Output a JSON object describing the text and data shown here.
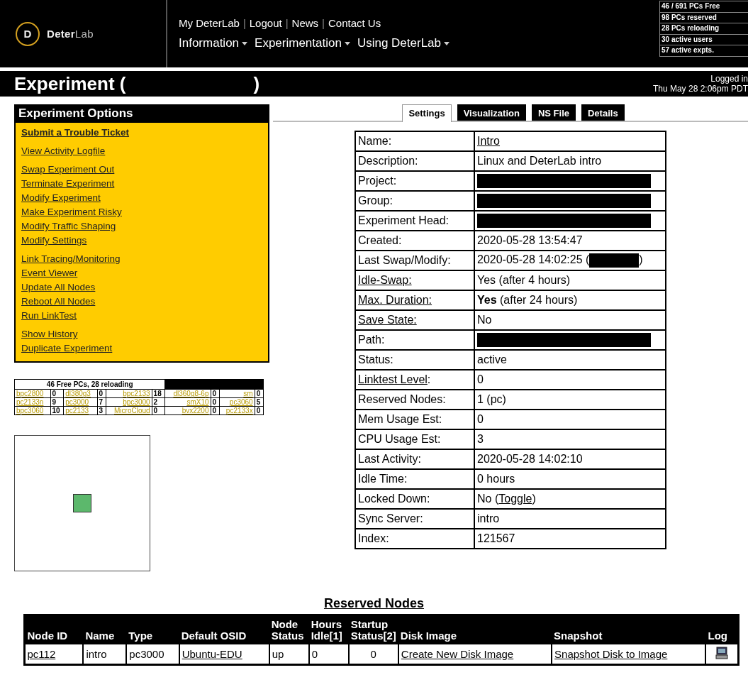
{
  "header": {
    "logo": {
      "letter": "D",
      "name_bold": "Deter",
      "name_light": "Lab"
    },
    "top_links": [
      "My DeterLab",
      "Logout",
      "News",
      "Contact Us"
    ],
    "separator": "|",
    "menus": [
      "Information",
      "Experimentation",
      "Using DeterLab"
    ],
    "stats": [
      "46 / 691 PCs Free",
      "98 PCs reserved",
      "28 PCs reloading",
      "30 active users",
      "57 active expts."
    ]
  },
  "title_bar": {
    "title": "Experiment (",
    "title_end": ")",
    "logged_in": "Logged in",
    "date": "Thu May 28 2:06pm PDT"
  },
  "options": {
    "title": "Experiment Options",
    "groups": [
      [
        {
          "label": "Submit a Trouble Ticket",
          "bold": true
        }
      ],
      [
        {
          "label": "View Activity Logfile",
          "bold": false
        }
      ],
      [
        {
          "label": "Swap Experiment Out",
          "bold": false
        },
        {
          "label": "Terminate Experiment",
          "bold": false
        },
        {
          "label": "Modify Experiment",
          "bold": false
        },
        {
          "label": "Make Experiment Risky",
          "bold": false
        },
        {
          "label": "Modify Traffic Shaping",
          "bold": false
        },
        {
          "label": "Modify Settings",
          "bold": false
        }
      ],
      [
        {
          "label": "Link Tracing/Monitoring",
          "bold": false
        },
        {
          "label": "Event Viewer",
          "bold": false
        },
        {
          "label": "Update All Nodes",
          "bold": false
        },
        {
          "label": "Reboot All Nodes",
          "bold": false
        },
        {
          "label": "Run LinkTest",
          "bold": false
        }
      ],
      [
        {
          "label": "Show History",
          "bold": false
        },
        {
          "label": "Duplicate Experiment",
          "bold": false
        }
      ]
    ]
  },
  "free_pcs": {
    "title": "46 Free PCs, 28 reloading",
    "rows": [
      [
        {
          "type": "bpc2800",
          "count": "0"
        },
        {
          "type": "dl380g3",
          "count": "0"
        },
        {
          "type": "bpc2133",
          "count": "18"
        },
        {
          "type": "dl360g8-6p",
          "count": "0"
        },
        {
          "type": "sm",
          "count": "0"
        }
      ],
      [
        {
          "type": "pc2133n",
          "count": "9"
        },
        {
          "type": "pc3000",
          "count": "7"
        },
        {
          "type": "bpc3000",
          "count": "2"
        },
        {
          "type": "smX10",
          "count": "0"
        },
        {
          "type": "pc3060",
          "count": "5"
        }
      ],
      [
        {
          "type": "bpc3060",
          "count": "10"
        },
        {
          "type": "pc2133",
          "count": "3"
        },
        {
          "type": "MicroCloud",
          "count": "0"
        },
        {
          "type": "bvx2200",
          "count": "0"
        },
        {
          "type": "pc2133x",
          "count": "0"
        }
      ]
    ]
  },
  "tabs": [
    {
      "label": "Settings",
      "selected": true
    },
    {
      "label": "Visualization",
      "selected": false
    },
    {
      "label": "NS File",
      "selected": false
    },
    {
      "label": "Details",
      "selected": false
    }
  ],
  "settings": [
    {
      "label": "Name:",
      "label_link": false,
      "value": [
        {
          "kind": "link",
          "text": "Intro"
        }
      ]
    },
    {
      "label": "Description:",
      "label_link": false,
      "value": [
        {
          "kind": "text",
          "text": "Linux and DeterLab intro"
        }
      ]
    },
    {
      "label": "Project:",
      "label_link": false,
      "value": [
        {
          "kind": "redacted"
        }
      ]
    },
    {
      "label": "Group:",
      "label_link": false,
      "value": [
        {
          "kind": "redacted"
        }
      ]
    },
    {
      "label": "Experiment Head:",
      "label_link": false,
      "value": [
        {
          "kind": "redacted"
        }
      ]
    },
    {
      "label": "Created:",
      "label_link": false,
      "value": [
        {
          "kind": "text",
          "text": "2020-05-28 13:54:47"
        }
      ]
    },
    {
      "label": "Last Swap/Modify:",
      "label_link": false,
      "value": [
        {
          "kind": "text",
          "text": "2020-05-28 14:02:25 ("
        },
        {
          "kind": "redacted_short"
        },
        {
          "kind": "text",
          "text": ")"
        }
      ]
    },
    {
      "label": "Idle-Swap:",
      "label_link": true,
      "value": [
        {
          "kind": "text",
          "text": "Yes (after 4 hours)"
        }
      ]
    },
    {
      "label": "Max. Duration:",
      "label_link": true,
      "value": [
        {
          "kind": "text",
          "text": "**Yes** (after 24 hours)"
        }
      ]
    },
    {
      "label": "Save State:",
      "label_link": true,
      "value": [
        {
          "kind": "text",
          "text": "No"
        }
      ]
    },
    {
      "label": "Path:",
      "label_link": false,
      "value": [
        {
          "kind": "redacted"
        }
      ]
    },
    {
      "label": "Status:",
      "label_link": false,
      "value": [
        {
          "kind": "text",
          "text": "active"
        }
      ]
    },
    {
      "label": "Linktest Level",
      "label_suffix": ":",
      "label_link": true,
      "value": [
        {
          "kind": "text",
          "text": "0"
        }
      ]
    },
    {
      "label": "Reserved Nodes:",
      "label_link": false,
      "value": [
        {
          "kind": "text",
          "text": "1 (pc)"
        }
      ]
    },
    {
      "label": "Mem Usage Est:",
      "label_link": false,
      "value": [
        {
          "kind": "text",
          "text": "0"
        }
      ]
    },
    {
      "label": "CPU Usage Est:",
      "label_link": false,
      "value": [
        {
          "kind": "text",
          "text": "3"
        }
      ]
    },
    {
      "label": "Last Activity:",
      "label_link": false,
      "value": [
        {
          "kind": "text",
          "text": "2020-05-28 14:02:10"
        }
      ]
    },
    {
      "label": "Idle Time:",
      "label_link": false,
      "value": [
        {
          "kind": "text",
          "text": "0 hours"
        }
      ]
    },
    {
      "label": "Locked Down:",
      "label_link": false,
      "value": [
        {
          "kind": "text",
          "text": "No ("
        },
        {
          "kind": "link",
          "text": "Toggle"
        },
        {
          "kind": "text",
          "text": ")"
        }
      ]
    },
    {
      "label": "Sync Server:",
      "label_link": false,
      "value": [
        {
          "kind": "text",
          "text": "intro"
        }
      ]
    },
    {
      "label": "Index:",
      "label_link": false,
      "value": [
        {
          "kind": "text",
          "text": "121567"
        }
      ]
    }
  ],
  "reserved_nodes": {
    "title": "Reserved Nodes",
    "columns": [
      {
        "label": "Node ID",
        "wrap": false
      },
      {
        "label": "Name",
        "wrap": false
      },
      {
        "label": "Type",
        "wrap": false
      },
      {
        "label": "Default OSID",
        "wrap": false
      },
      {
        "label": "Node Status",
        "wrap": true
      },
      {
        "label": "Hours Idle[1]",
        "wrap": true
      },
      {
        "label": "Startup Status[2]",
        "wrap": true
      },
      {
        "label": "Disk Image",
        "wrap": false
      },
      {
        "label": "Snapshot",
        "wrap": false
      },
      {
        "label": "Log",
        "wrap": false
      }
    ],
    "rows": [
      [
        {
          "kind": "link",
          "text": "pc112"
        },
        {
          "kind": "text",
          "text": "intro"
        },
        {
          "kind": "text",
          "text": "pc3000"
        },
        {
          "kind": "link",
          "text": "Ubuntu-EDU"
        },
        {
          "kind": "text",
          "text": "up"
        },
        {
          "kind": "text",
          "text": "0"
        },
        {
          "kind": "center",
          "text": "0"
        },
        {
          "kind": "link",
          "text": "Create New Disk Image"
        },
        {
          "kind": "link",
          "text": "Snapshot Disk to Image"
        },
        {
          "kind": "icon"
        }
      ]
    ]
  }
}
